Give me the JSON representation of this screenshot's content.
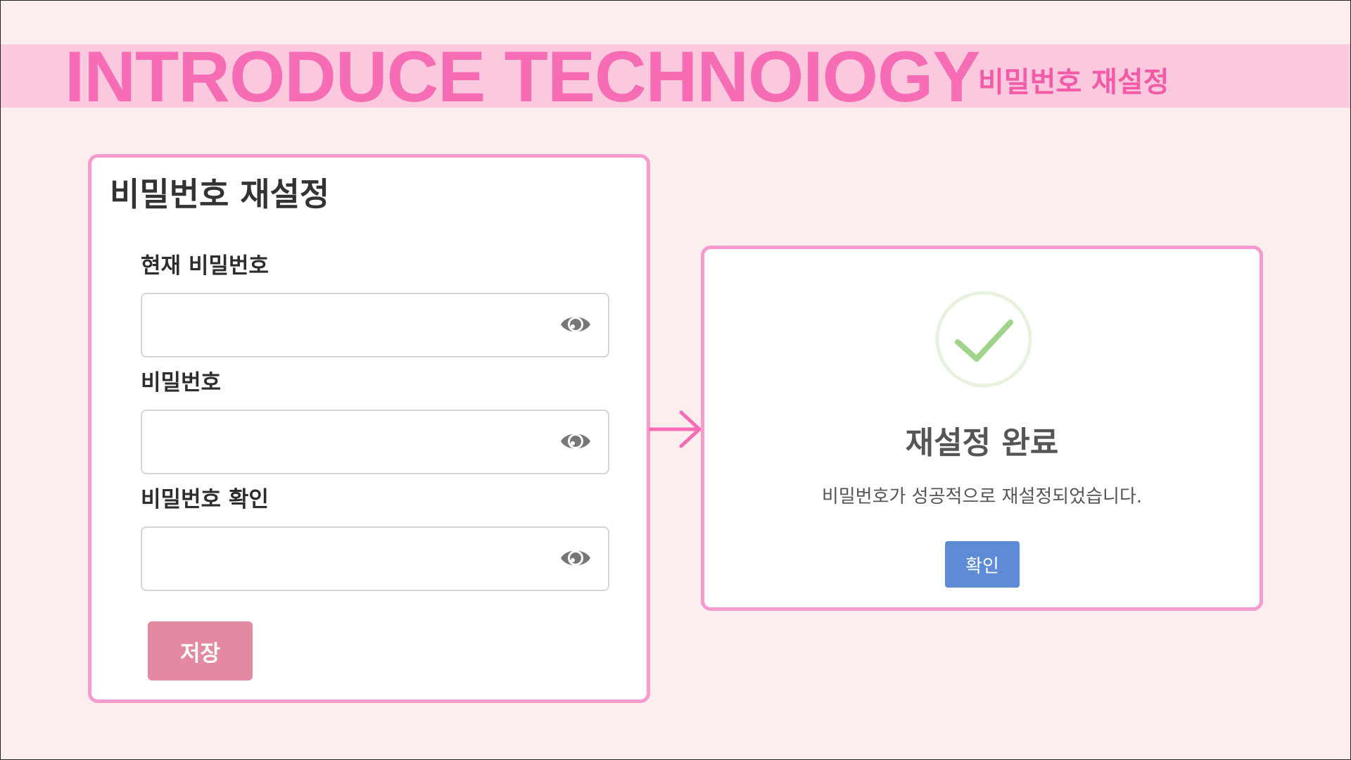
{
  "banner": {
    "title": "INTRODUCE TECHNOIOGY",
    "subtitle": "비밀번호 재설정"
  },
  "reset_form": {
    "title": "비밀번호 재설정",
    "fields": [
      {
        "label": "현재 비밀번호",
        "value": "",
        "placeholder": "",
        "icon": "eye-icon"
      },
      {
        "label": "비밀번호",
        "value": "",
        "placeholder": "",
        "icon": "eye-icon"
      },
      {
        "label": "비밀번호 확인",
        "value": "",
        "placeholder": "",
        "icon": "eye-icon"
      }
    ],
    "save_label": "저장"
  },
  "flow_arrow": {
    "icon": "arrow-right-icon"
  },
  "success_dialog": {
    "icon": "checkmark-circle-icon",
    "title": "재설정 완료",
    "message": "비밀번호가 성공적으로 재설정되었습니다.",
    "confirm_label": "확인"
  },
  "colors": {
    "background": "#fdeeee",
    "banner": "#fcc8de",
    "banner_text": "#f66cb5",
    "card_border": "#f79ad0",
    "save_button": "#e38aa2",
    "confirm_button": "#5d8bd5",
    "check": "#9fd48b"
  }
}
